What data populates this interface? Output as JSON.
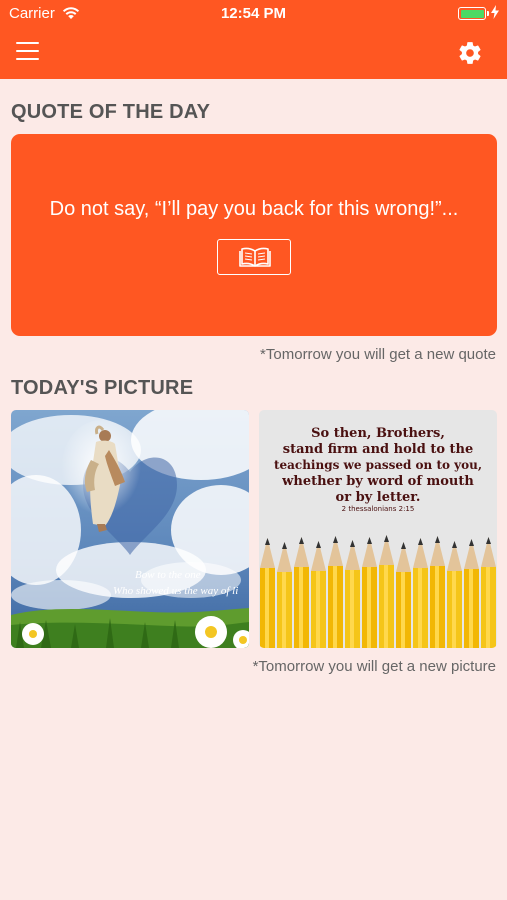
{
  "status_bar": {
    "carrier": "Carrier",
    "time": "12:54 PM",
    "battery_level": 1.0
  },
  "header": {
    "menu_icon": "hamburger-menu-icon",
    "settings_icon": "gear-icon",
    "background_color": "#ff5722"
  },
  "quote_section": {
    "title": "QUOTE OF THE DAY",
    "quote": "Do not say, “I’ll pay you back for this wrong!”...",
    "read_icon": "open-book-icon",
    "note": "*Tomorrow you will get a new quote"
  },
  "picture_section": {
    "title": "TODAY'S PICTURE",
    "pictures": [
      {
        "caption_lines": [
          "Bow to the one",
          "Who showed us the way of li"
        ]
      },
      {
        "verse_lines": [
          "So then, Brothers,",
          "stand firm and hold to the",
          "teachings we passed on to you,",
          "whether by word of mouth",
          "or by letter."
        ],
        "reference": "2 thessalonians 2:15"
      }
    ],
    "note": "*Tomorrow you will get a new picture"
  }
}
